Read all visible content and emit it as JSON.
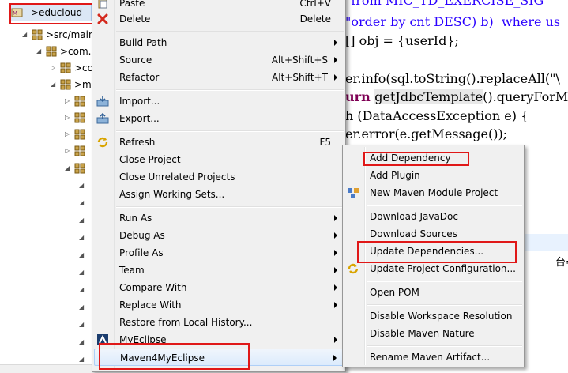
{
  "explorer": {
    "project_name": ">educloud",
    "tree": [
      {
        "label": ">src/main",
        "depth": 1
      },
      {
        "label": ">com.",
        "depth": 2
      },
      {
        "label": ">co",
        "depth": 3
      },
      {
        "label": ">m",
        "depth": 3
      }
    ]
  },
  "editor": {
    "lines": [
      {
        "parts": [
          {
            "t": "\"from MIC_TD_EXERCISE_SIG",
            "c": "str"
          }
        ]
      },
      {
        "parts": [
          {
            "t": "\"order by cnt DESC) b)  where us",
            "c": "str"
          }
        ]
      },
      {
        "parts": [
          {
            "t": "[] obj = {userId};",
            "c": "mth"
          }
        ]
      },
      {
        "parts": []
      },
      {
        "parts": [
          {
            "t": "er.info(sql.toString().replaceAll(\"\\",
            "c": "mth"
          }
        ]
      },
      {
        "parts": [
          {
            "t": "urn ",
            "c": "kw"
          },
          {
            "t": "getJdbcTemplate",
            "c": "hl"
          },
          {
            "t": "().queryForM",
            "c": "mth"
          }
        ]
      },
      {
        "parts": [
          {
            "t": "h (DataAccessException e) {",
            "c": "mth"
          }
        ]
      },
      {
        "parts": [
          {
            "t": "er.error(e.getMessage());",
            "c": "mth"
          }
        ]
      }
    ],
    "partial_text": "台="
  },
  "context_menu": {
    "items": [
      {
        "label": "Paste",
        "accel": "Ctrl+V",
        "icon": "paste-icon"
      },
      {
        "label": "Delete",
        "accel": "Delete",
        "icon": "delete-icon"
      },
      {
        "label": "Build Path",
        "submenu": true
      },
      {
        "label": "Source",
        "accel": "Alt+Shift+S",
        "submenu": true
      },
      {
        "label": "Refactor",
        "accel": "Alt+Shift+T",
        "submenu": true
      },
      {
        "label": "Import...",
        "icon": "import-icon"
      },
      {
        "label": "Export...",
        "icon": "export-icon"
      },
      {
        "label": "Refresh",
        "accel": "F5",
        "icon": "refresh-icon"
      },
      {
        "label": "Close Project"
      },
      {
        "label": "Close Unrelated Projects"
      },
      {
        "label": "Assign Working Sets..."
      },
      {
        "label": "Run As",
        "submenu": true
      },
      {
        "label": "Debug As",
        "submenu": true
      },
      {
        "label": "Profile As",
        "submenu": true
      },
      {
        "label": "Team",
        "submenu": true
      },
      {
        "label": "Compare With",
        "submenu": true
      },
      {
        "label": "Replace With",
        "submenu": true
      },
      {
        "label": "Restore from Local History..."
      },
      {
        "label": "MyEclipse",
        "submenu": true,
        "icon": "myeclipse-icon"
      },
      {
        "label": "Maven4MyEclipse",
        "submenu": true
      }
    ]
  },
  "maven_submenu": {
    "items": [
      {
        "label": "Add Dependency"
      },
      {
        "label": "Add Plugin"
      },
      {
        "label": "New Maven Module Project",
        "icon": "maven-module-icon"
      },
      {
        "label": "Download JavaDoc"
      },
      {
        "label": "Download Sources"
      },
      {
        "label": "Update Dependencies..."
      },
      {
        "label": "Update Project Configuration...",
        "icon": "update-config-icon"
      },
      {
        "label": "Open POM"
      },
      {
        "label": "Disable Workspace Resolution"
      },
      {
        "label": "Disable Maven Nature"
      },
      {
        "label": "Rename Maven Artifact..."
      }
    ]
  },
  "colors": {
    "highlight_box": "#e01818",
    "menu_bg": "#f0f0f0",
    "string_literal": "#2a00ff",
    "keyword": "#7f0055"
  }
}
